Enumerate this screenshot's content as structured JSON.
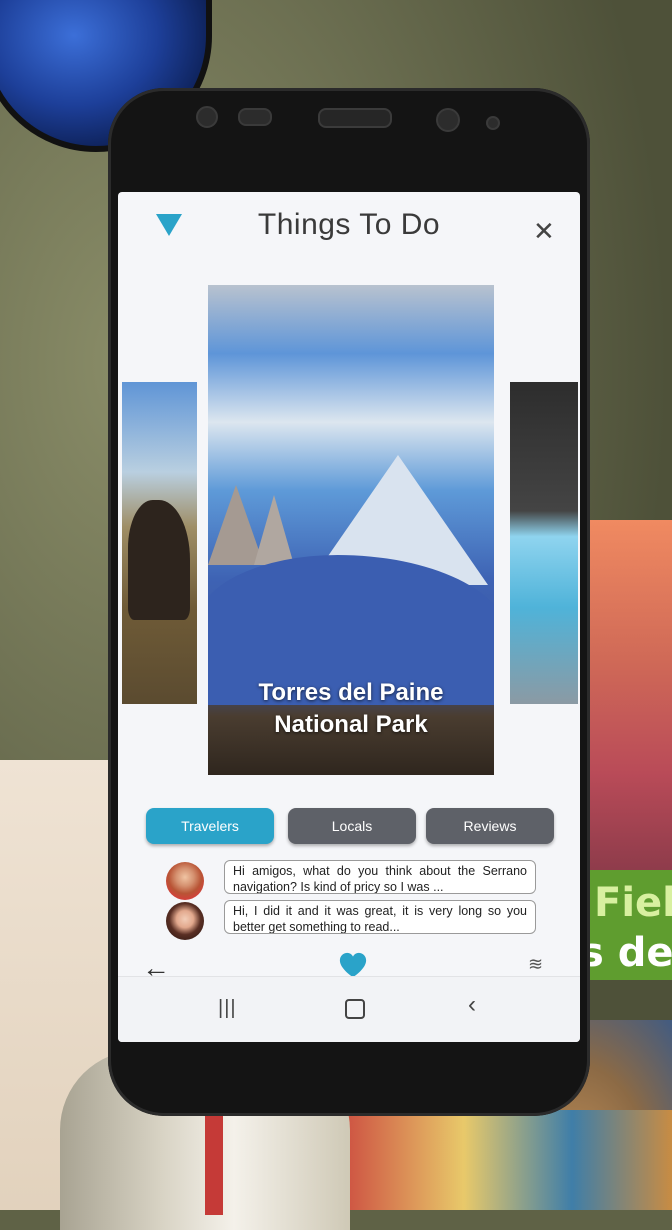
{
  "header": {
    "title": "Things To Do",
    "menu_icon": "triangle-down-icon",
    "close_label": "✕"
  },
  "carousel": {
    "main_card_title": "Torres del Paine\nNational Park"
  },
  "tabs": [
    {
      "label": "Travelers",
      "active": true
    },
    {
      "label": "Locals",
      "active": false
    },
    {
      "label": "Reviews",
      "active": false
    }
  ],
  "comments": [
    {
      "text": "Hi amigos, what do you think about the Serrano navigation? Is kind of pricy so I was ..."
    },
    {
      "text": "Hi, I did it and it was great, it is very long so you better get something to read..."
    }
  ],
  "footer": {
    "back_label": "←",
    "heart_icon": "heart-icon",
    "filter_label": "≋"
  },
  "navbar": {
    "recent_label": "|||",
    "back_label": "‹"
  },
  "postcard": {
    "line1": "Field",
    "line2": "s del"
  },
  "colors": {
    "accent": "#2aa3c9",
    "tab_inactive": "#5e6168"
  }
}
